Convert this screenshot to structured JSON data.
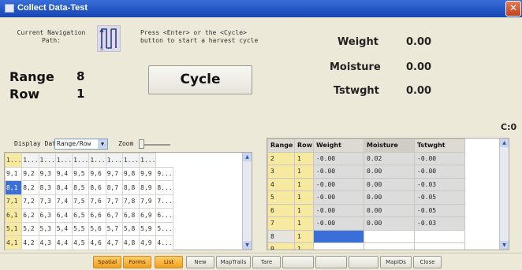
{
  "window": {
    "title": "Collect Data-Test",
    "close_label": "✕"
  },
  "top": {
    "nav_label_line1": "Current Navigation",
    "nav_label_line2": "Path:",
    "instructions_line1": "Press <Enter> or the <Cycle>",
    "instructions_line2": "button to start a harvest cycle",
    "range_label": "Range",
    "range_value": "8",
    "row_label": "Row",
    "row_value": "1",
    "cycle_label": "Cycle",
    "stats": [
      {
        "label": "Weight",
        "value": "0.00"
      },
      {
        "label": "Moisture",
        "value": "0.00"
      },
      {
        "label": "Tstwght",
        "value": "0.00"
      }
    ],
    "c0_label": "C:0"
  },
  "display": {
    "label": "Display Data",
    "select_value": "Range/Row",
    "zoom_label": "Zoom",
    "zoom_level": 0.0
  },
  "map": {
    "header": [
      "1...",
      "1...",
      "1...",
      "1...",
      "1...",
      "1...",
      "1...",
      "1...",
      "1..."
    ],
    "rows": [
      [
        "9,1",
        "9,2",
        "9,3",
        "9,4",
        "9,5",
        "9,6",
        "9,7",
        "9,8",
        "9,9",
        "9..."
      ],
      [
        "8,1",
        "8,2",
        "8,3",
        "8,4",
        "8,5",
        "8,6",
        "8,7",
        "8,8",
        "8,9",
        "8..."
      ],
      [
        "7,1",
        "7,2",
        "7,3",
        "7,4",
        "7,5",
        "7,6",
        "7,7",
        "7,8",
        "7,9",
        "7..."
      ],
      [
        "6,1",
        "6,2",
        "6,3",
        "6,4",
        "6,5",
        "6,6",
        "6,7",
        "6,8",
        "6,9",
        "6..."
      ],
      [
        "5,1",
        "5,2",
        "5,3",
        "5,4",
        "5,5",
        "5,6",
        "5,7",
        "5,8",
        "5,9",
        "5..."
      ],
      [
        "4,1",
        "4,2",
        "4,3",
        "4,4",
        "4,5",
        "4,6",
        "4,7",
        "4,8",
        "4,9",
        "4..."
      ]
    ]
  },
  "results": {
    "columns": [
      "Range",
      "Row",
      "Weight",
      "Moisture",
      "Tstwght"
    ],
    "rows": [
      [
        "2",
        "1",
        "-0.00",
        "0.02",
        "-0.00"
      ],
      [
        "3",
        "1",
        "-0.00",
        "0.00",
        "-0.00"
      ],
      [
        "4",
        "1",
        "-0.00",
        "0.00",
        "-0.03"
      ],
      [
        "5",
        "1",
        "-0.00",
        "0.00",
        "-0.05"
      ],
      [
        "6",
        "1",
        "-0.00",
        "0.00",
        "-0.05"
      ],
      [
        "7",
        "1",
        "-0.00",
        "0.00",
        "-0.03"
      ],
      [
        "8",
        "1",
        "",
        "",
        ""
      ],
      [
        "9",
        "1",
        "",
        "",
        ""
      ]
    ]
  },
  "buttons": [
    {
      "label": "Spatial",
      "style": "orange"
    },
    {
      "label": "Forms",
      "style": "orange"
    },
    {
      "label": "List",
      "style": "orange"
    },
    {
      "label": "New",
      "style": "plain"
    },
    {
      "label": "MapTrails",
      "style": "plain"
    },
    {
      "label": "Tare",
      "style": "plain"
    },
    {
      "label": "",
      "style": "plain"
    },
    {
      "label": "",
      "style": "plain"
    },
    {
      "label": "",
      "style": "plain"
    },
    {
      "label": "MapIDs",
      "style": "plain"
    },
    {
      "label": "Close",
      "style": "plain"
    }
  ],
  "colors": {
    "titlebar": "#2154c4",
    "row_label_bg": "#f7eaa0",
    "selection": "#3a6fd8",
    "orange_button": "#f0a020"
  }
}
